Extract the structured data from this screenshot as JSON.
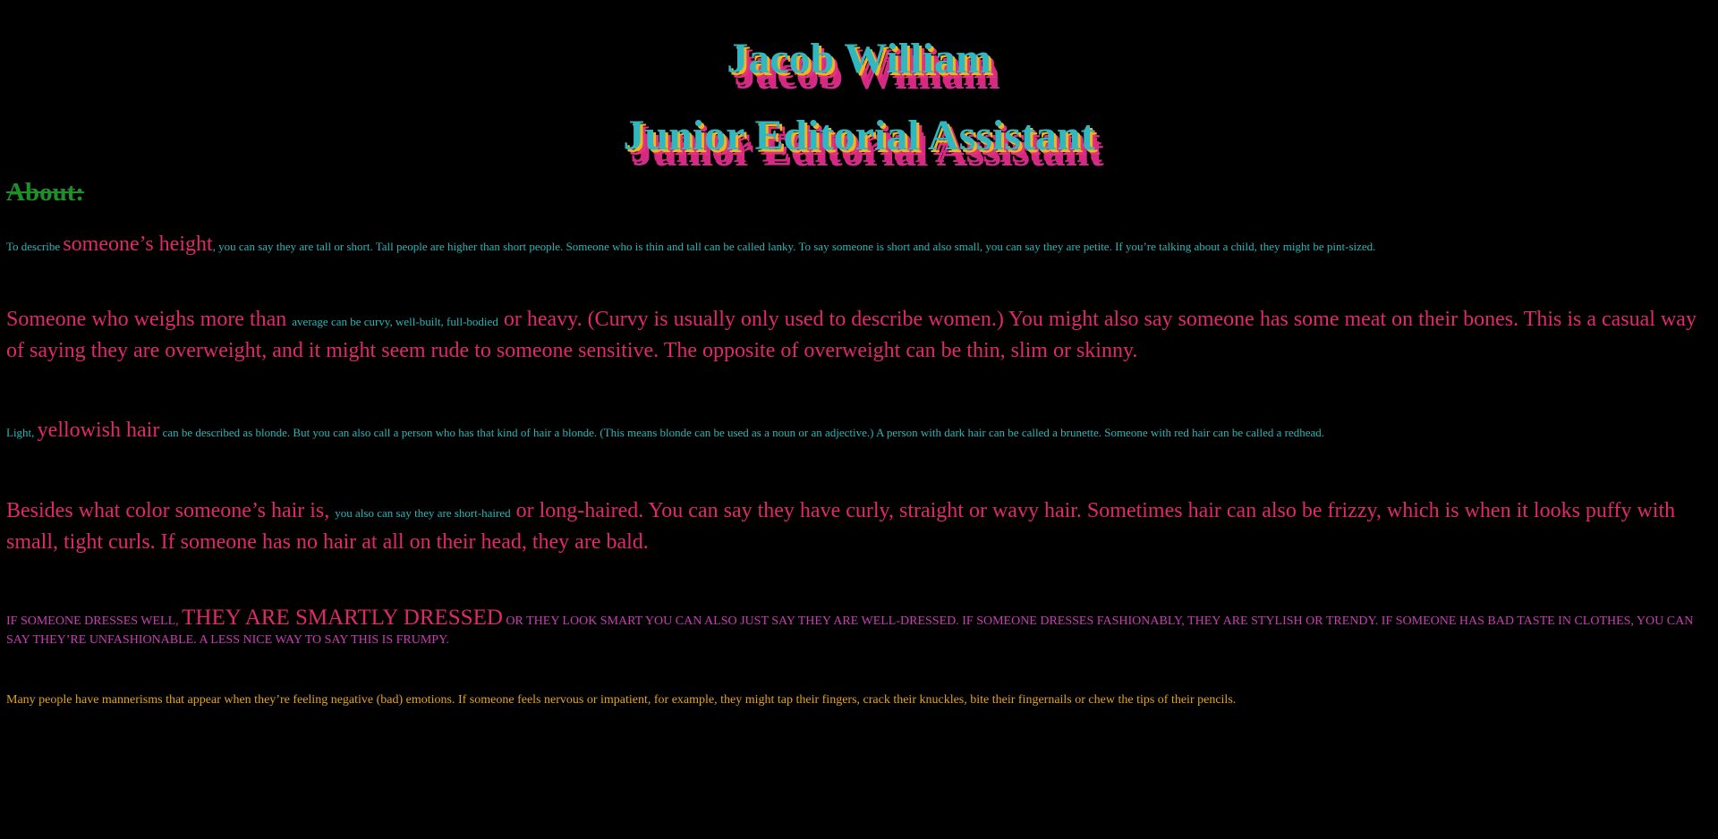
{
  "header": {
    "name": "Jacob William",
    "role": "Junior Editorial Assistant"
  },
  "about": {
    "heading": "About:"
  },
  "paragraphs": {
    "p1": {
      "a": "To describe ",
      "b": "someone’s height",
      "c": ", you can say they are tall or short. Tall people are higher than short people. Someone who is thin and tall can be called lanky. To say someone is short and also small, you can say they are petite. If you’re talking about a child, they might be pint-sized."
    },
    "p2": {
      "a": "Someone who weighs more than ",
      "b": "average can be curvy, well-built, full-bodied",
      "c": " or heavy. (Curvy is usually only used to describe women.) You might also say someone has some meat on their bones. This is a casual way of saying they are overweight, and it might seem rude to someone sensitive. The opposite of overweight can be thin, slim or skinny."
    },
    "p3": {
      "a": "Light, ",
      "b": "yellowish hair",
      "c": " can be described as blonde. But you can also call a person who has that kind of hair a blonde. (This means blonde can be used as a noun or an adjective.) A person with dark hair can be called a brunette. Someone with red hair can be called a redhead."
    },
    "p4": {
      "a": "Besides what color someone’s hair is, ",
      "b": "you also can say they are short-haired",
      "c": " or long-haired. You can say they have curly, straight or wavy hair. Sometimes hair can also be frizzy, which is when it looks puffy with small, tight curls. If someone has no hair at all on their head, they are bald."
    },
    "p5": {
      "a": "If someone dresses well, ",
      "b": "they are smartly dressed",
      "c": " or they look smart You can also just say they are well-dressed. If someone dresses fashionably, they are stylish or trendy. If someone has bad taste in clothes, you can say they’re unfashionable. A less nice way to say this is frumpy."
    },
    "p6": {
      "text": "Many people have mannerisms that appear when they’re feeling negative (bad) emotions. If someone feels nervous or impatient, for example, they might tap their fingers, crack their knuckles, bite their fingernails or chew the tips of their pencils."
    }
  },
  "colors": {
    "background": "#000000",
    "heading_fill": "#2fb7c2",
    "heading_shadow_yellow": "#f0b51f",
    "heading_shadow_pink": "#e2337a",
    "about_green": "#1f8f2a",
    "teal_text": "#2bb5b5",
    "red_text": "#e0286b",
    "magenta_text": "#c93fb3",
    "gold_text": "#e2a322"
  }
}
